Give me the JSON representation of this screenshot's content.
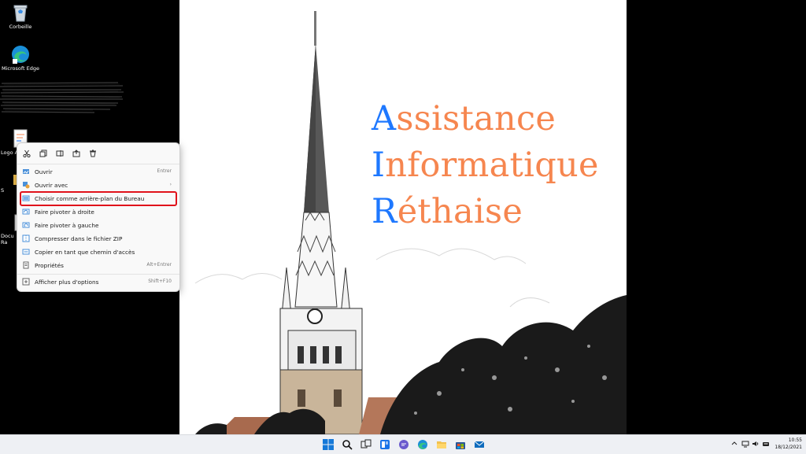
{
  "desktop_icons": [
    {
      "label": "Corbeille",
      "icon": "recycle-bin-icon"
    },
    {
      "label": "Microsoft Edge",
      "icon": "edge-icon"
    },
    {
      "label": "Logo A",
      "icon": "image-file-icon"
    },
    {
      "label": "S",
      "icon": "folder-icon"
    },
    {
      "label": "Docu",
      "icon": "document-icon"
    },
    {
      "label": "Ra",
      "icon": "document-icon"
    }
  ],
  "wallpaper": {
    "lines": [
      {
        "initial": "A",
        "rest": "ssistance"
      },
      {
        "initial": "I",
        "rest": "nformatique"
      },
      {
        "initial": "R",
        "rest": "éthaise"
      }
    ],
    "initial_color": "#1e78ff",
    "rest_color": "#f6864f"
  },
  "context_menu": {
    "quick_actions": [
      "cut-icon",
      "copy-icon",
      "rename-icon",
      "share-icon",
      "delete-icon"
    ],
    "items": [
      {
        "label": "Ouvrir",
        "shortcut": "Entrer",
        "icon": "open-icon"
      },
      {
        "label": "Ouvrir avec",
        "shortcut": "›",
        "icon": "open-with-icon"
      },
      {
        "label": "Choisir comme arrière-plan du Bureau",
        "shortcut": "",
        "icon": "wallpaper-icon",
        "highlighted": true
      },
      {
        "label": "Faire pivoter à droite",
        "shortcut": "",
        "icon": "rotate-right-icon"
      },
      {
        "label": "Faire pivoter à gauche",
        "shortcut": "",
        "icon": "rotate-left-icon"
      },
      {
        "label": "Compresser dans le fichier ZIP",
        "shortcut": "",
        "icon": "zip-icon"
      },
      {
        "label": "Copier en tant que chemin d'accès",
        "shortcut": "",
        "icon": "copy-path-icon"
      },
      {
        "label": "Propriétés",
        "shortcut": "Alt+Entrer",
        "icon": "properties-icon"
      },
      {
        "label": "Afficher plus d'options",
        "shortcut": "Shift+F10",
        "icon": "more-options-icon"
      }
    ]
  },
  "taskbar": {
    "apps": [
      "start-icon",
      "search-icon",
      "task-view-icon",
      "widgets-icon",
      "chat-icon",
      "edge-icon",
      "file-explorer-icon",
      "store-icon",
      "mail-icon"
    ],
    "tray": [
      "chevron-up-icon",
      "network-icon",
      "volume-icon",
      "keyboard-icon"
    ],
    "time": "10:55",
    "date": "18/12/2021"
  },
  "colors": {
    "highlight_border": "#e0121b",
    "taskbar_bg": "#eef0f4"
  }
}
